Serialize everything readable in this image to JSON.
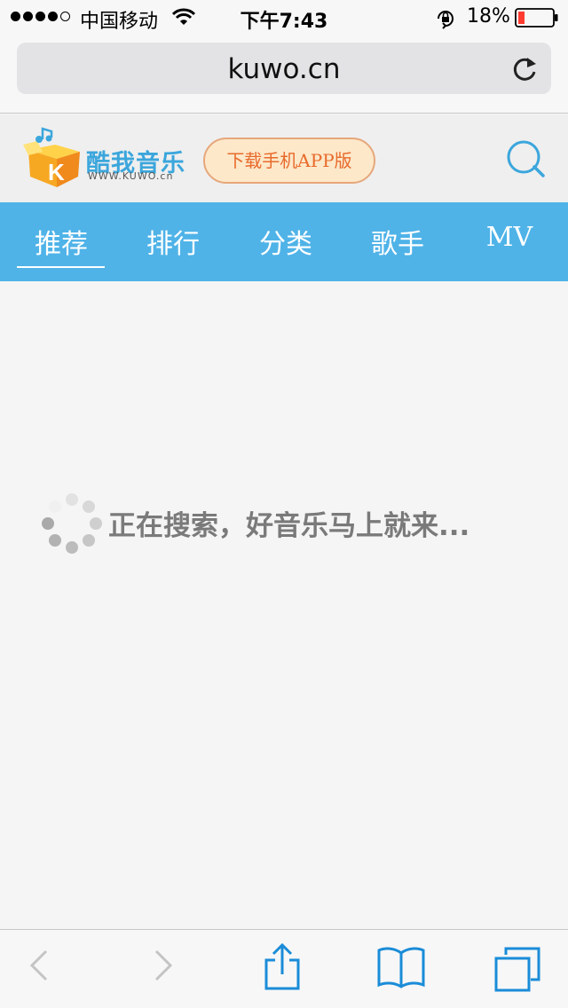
{
  "status_bar": {
    "carrier": "中国移动",
    "time": "下午7:43",
    "battery": "18%"
  },
  "browser": {
    "url": "kuwo.cn"
  },
  "header": {
    "logo_name": "酷我音乐",
    "logo_url": "WWW.KUWO.cn",
    "download_label": "下载手机APP版"
  },
  "nav": {
    "items": [
      {
        "label": "推荐",
        "active": true
      },
      {
        "label": "排行"
      },
      {
        "label": "分类"
      },
      {
        "label": "歌手"
      },
      {
        "label": "MV"
      }
    ]
  },
  "content": {
    "loading_text": "正在搜索，好音乐马上就来..."
  },
  "icons": {
    "signal": "signal-dots-icon",
    "wifi": "wifi-icon",
    "orientation_lock": "orientation-lock-icon",
    "battery": "battery-icon",
    "reload": "reload-icon",
    "search": "search-icon",
    "spinner": "loading-spinner-icon",
    "back": "back-icon",
    "forward": "forward-icon",
    "share": "share-icon",
    "bookmarks": "bookmarks-icon",
    "tabs": "tabs-icon"
  },
  "colors": {
    "accent": "#4fb3e8",
    "logo_blue": "#3ba6dc",
    "download_text": "#e86a2c",
    "download_bg": "#fde8c9",
    "toolbar_icon": "#1a8cd8",
    "battery_low": "#ff3b30"
  }
}
